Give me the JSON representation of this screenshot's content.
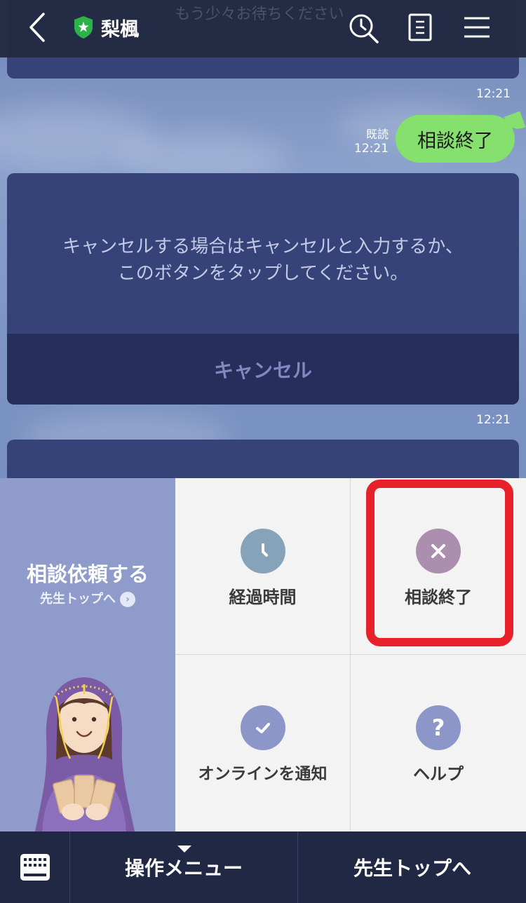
{
  "header": {
    "title": "梨楓",
    "ghost_text": "もう少々お待ちください",
    "icons": [
      "back-icon",
      "shield-star-icon",
      "search-clock-icon",
      "notes-icon",
      "hamburger-menu-icon"
    ]
  },
  "chat": {
    "timestamp_1": "12:21",
    "read_label": "既読",
    "read_time": "12:21",
    "sent_message": "相談終了",
    "cancel_card": {
      "text": "キャンセルする場合はキャンセルと入力するか、\nこのボタンをタップしてください。",
      "button_label": "キャンセル"
    },
    "timestamp_2": "12:21"
  },
  "rich_menu": {
    "promo": {
      "title": "相談依頼する",
      "subtitle": "先生トップへ",
      "chevron": "›"
    },
    "cells": [
      {
        "label": "経過時間",
        "icon": "clock-icon",
        "color": "#86a3ba"
      },
      {
        "label": "相談終了",
        "icon": "close-icon",
        "color": "#ac8eae"
      },
      {
        "label": "オンラインを通知",
        "icon": "check-icon",
        "color": "#8c96c8"
      },
      {
        "label": "ヘルプ",
        "icon": "question-icon",
        "color": "#8c96c8",
        "glyph": "?"
      }
    ],
    "highlight_color": "#e8202a"
  },
  "bottom_bar": {
    "keyboard_icon": "keyboard-icon",
    "menu_label": "操作メニュー",
    "teacher_top_label": "先生トップへ"
  },
  "colors": {
    "header_bg": "#242a42",
    "card_bg": "#364379",
    "bubble_green": "#85e06d",
    "bottom_bar_bg": "#212843",
    "promo_bg": "#8f9ccb"
  }
}
